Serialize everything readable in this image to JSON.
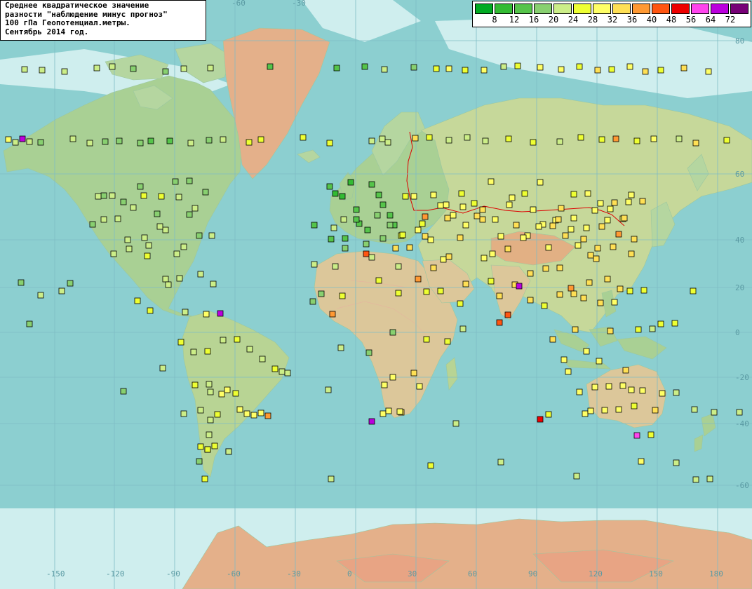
{
  "title": {
    "lines": [
      "Среднее квадратическое значение",
      "разности \"наблюдение минус прогноз\"",
      "100 гПа Геопотенциал.метры.",
      "Сентябрь 2014 год."
    ]
  },
  "legend": {
    "labels": [
      "8",
      "12",
      "16",
      "20",
      "24",
      "28",
      "32",
      "36",
      "40",
      "48",
      "56",
      "64",
      "72"
    ],
    "colors": [
      "#00aa22",
      "#33bb33",
      "#55c44a",
      "#88d070",
      "#ccee88",
      "#eeff33",
      "#ffff66",
      "#ffe055",
      "#ff9933",
      "#ff5511",
      "#ee0000",
      "#ff44ee",
      "#bb00dd",
      "#770077"
    ]
  },
  "map_colors": {
    "ocean": "#8ccfd0",
    "land_low": "#a3ce94",
    "land_mid": "#dcc79a",
    "land_high": "#e8a484",
    "ice": "#ccecee",
    "border": "#dd0000",
    "grid": "#7fbcc4"
  },
  "grid": {
    "lon_labels": [
      "-150",
      "-120",
      "-90",
      "-60",
      "-30",
      "0",
      "30",
      "60",
      "90",
      "120",
      "150",
      "180"
    ],
    "lat_labels": [
      "80",
      "60",
      "40",
      "20",
      "0",
      "-20",
      "-40",
      "-60"
    ],
    "top_lon_labels": [
      "-60",
      "-30"
    ]
  },
  "stations": [
    [
      12,
      6
    ],
    [
      22,
      4
    ],
    [
      42,
      4
    ],
    [
      32,
      12
    ],
    [
      58,
      3
    ],
    [
      104,
      4
    ],
    [
      128,
      4
    ],
    [
      150,
      3
    ],
    [
      170,
      3
    ],
    [
      200,
      3
    ],
    [
      215,
      2
    ],
    [
      242,
      2
    ],
    [
      272,
      4
    ],
    [
      298,
      3
    ],
    [
      318,
      4
    ],
    [
      355,
      5
    ],
    [
      372,
      5
    ],
    [
      432,
      5
    ],
    [
      470,
      5
    ],
    [
      530,
      4
    ],
    [
      545,
      4
    ],
    [
      553,
      4
    ],
    [
      592,
      7
    ],
    [
      612,
      5
    ],
    [
      640,
      4
    ],
    [
      666,
      4
    ],
    [
      692,
      4
    ],
    [
      725,
      5
    ],
    [
      760,
      5
    ],
    [
      798,
      4
    ],
    [
      828,
      5
    ],
    [
      858,
      5
    ],
    [
      878,
      8
    ],
    [
      908,
      5
    ],
    [
      932,
      6
    ],
    [
      968,
      4
    ],
    [
      992,
      7
    ],
    [
      1036,
      5
    ],
    [
      35,
      4
    ],
    [
      60,
      4
    ],
    [
      92,
      4
    ],
    [
      138,
      4
    ],
    [
      160,
      4
    ],
    [
      190,
      3
    ],
    [
      236,
      3
    ],
    [
      262,
      4
    ],
    [
      300,
      4
    ],
    [
      385,
      2
    ],
    [
      480,
      2
    ],
    [
      520,
      2
    ],
    [
      548,
      4
    ],
    [
      590,
      3
    ],
    [
      622,
      5
    ],
    [
      640,
      6
    ],
    [
      663,
      5
    ],
    [
      690,
      6
    ],
    [
      718,
      4
    ],
    [
      738,
      5
    ],
    [
      770,
      6
    ],
    [
      800,
      6
    ],
    [
      826,
      5
    ],
    [
      852,
      7
    ],
    [
      872,
      5
    ],
    [
      898,
      6
    ],
    [
      920,
      7
    ],
    [
      942,
      5
    ],
    [
      975,
      7
    ],
    [
      1010,
      6
    ],
    [
      132,
      3
    ],
    [
      148,
      3
    ],
    [
      176,
      3
    ],
    [
      200,
      3
    ],
    [
      224,
      3
    ],
    [
      250,
      3
    ],
    [
      270,
      3
    ],
    [
      293,
      3
    ],
    [
      470,
      2
    ],
    [
      478,
      1
    ],
    [
      488,
      1
    ],
    [
      500,
      1
    ],
    [
      512,
      2
    ],
    [
      530,
      2
    ],
    [
      546,
      2
    ],
    [
      562,
      2
    ],
    [
      578,
      5
    ],
    [
      602,
      5
    ],
    [
      618,
      6
    ],
    [
      636,
      6
    ],
    [
      658,
      5
    ],
    [
      676,
      5
    ],
    [
      700,
      6
    ],
    [
      726,
      6
    ],
    [
      748,
      5
    ],
    [
      770,
      6
    ],
    [
      792,
      6
    ],
    [
      818,
      5
    ],
    [
      838,
      6
    ],
    [
      856,
      6
    ],
    [
      876,
      7
    ],
    [
      896,
      6
    ],
    [
      916,
      7
    ],
    [
      140,
      4
    ],
    [
      160,
      4
    ],
    [
      182,
      4
    ],
    [
      205,
      5
    ],
    [
      230,
      5
    ],
    [
      255,
      4
    ],
    [
      278,
      4
    ],
    [
      302,
      4
    ],
    [
      472,
      2
    ],
    [
      492,
      2
    ],
    [
      508,
      2
    ],
    [
      524,
      2
    ],
    [
      540,
      2
    ],
    [
      556,
      2
    ],
    [
      572,
      5
    ],
    [
      590,
      6
    ],
    [
      606,
      8
    ],
    [
      628,
      6
    ],
    [
      646,
      6
    ],
    [
      664,
      6
    ],
    [
      688,
      7
    ],
    [
      706,
      6
    ],
    [
      730,
      6
    ],
    [
      752,
      6
    ],
    [
      774,
      6
    ],
    [
      796,
      7
    ],
    [
      814,
      6
    ],
    [
      832,
      7
    ],
    [
      848,
      6
    ],
    [
      866,
      6
    ],
    [
      882,
      8
    ],
    [
      900,
      6
    ],
    [
      148,
      4
    ],
    [
      168,
      4
    ],
    [
      190,
      4
    ],
    [
      212,
      4
    ],
    [
      236,
      4
    ],
    [
      262,
      4
    ],
    [
      284,
      3
    ],
    [
      476,
      4
    ],
    [
      492,
      3
    ],
    [
      508,
      2
    ],
    [
      522,
      3
    ],
    [
      538,
      3
    ],
    [
      556,
      3
    ],
    [
      574,
      5
    ],
    [
      596,
      6
    ],
    [
      614,
      6
    ],
    [
      638,
      7
    ],
    [
      660,
      6
    ],
    [
      688,
      7
    ],
    [
      714,
      6
    ],
    [
      736,
      7
    ],
    [
      760,
      6
    ],
    [
      782,
      6
    ],
    [
      800,
      7
    ],
    [
      818,
      6
    ],
    [
      836,
      6
    ],
    [
      852,
      7
    ],
    [
      870,
      6
    ],
    [
      888,
      6
    ],
    [
      904,
      7
    ],
    [
      162,
      4
    ],
    [
      184,
      4
    ],
    [
      206,
      4
    ],
    [
      228,
      4
    ],
    [
      252,
      4
    ],
    [
      270,
      3
    ],
    [
      448,
      2
    ],
    [
      490,
      4
    ],
    [
      522,
      9
    ],
    [
      546,
      3
    ],
    [
      564,
      7
    ],
    [
      584,
      7
    ],
    [
      606,
      7
    ],
    [
      632,
      6
    ],
    [
      656,
      7
    ],
    [
      680,
      7
    ],
    [
      702,
      6
    ],
    [
      724,
      7
    ],
    [
      746,
      6
    ],
    [
      768,
      6
    ],
    [
      788,
      7
    ],
    [
      806,
      7
    ],
    [
      824,
      6
    ],
    [
      842,
      7
    ],
    [
      858,
      7
    ],
    [
      874,
      7
    ],
    [
      890,
      7
    ],
    [
      210,
      5
    ],
    [
      236,
      4
    ],
    [
      256,
      4
    ],
    [
      286,
      4
    ],
    [
      304,
      4
    ],
    [
      448,
      4
    ],
    [
      478,
      4
    ],
    [
      530,
      4
    ],
    [
      568,
      4
    ],
    [
      596,
      8
    ],
    [
      618,
      7
    ],
    [
      640,
      7
    ],
    [
      664,
      7
    ],
    [
      690,
      6
    ],
    [
      712,
      7
    ],
    [
      734,
      7
    ],
    [
      756,
      7
    ],
    [
      778,
      7
    ],
    [
      798,
      7
    ],
    [
      814,
      8
    ],
    [
      832,
      7
    ],
    [
      850,
      7
    ],
    [
      866,
      7
    ],
    [
      884,
      7
    ],
    [
      900,
      7
    ],
    [
      30,
      3
    ],
    [
      42,
      3
    ],
    [
      88,
      4
    ],
    [
      100,
      3
    ],
    [
      58,
      4
    ],
    [
      196,
      5
    ],
    [
      214,
      5
    ],
    [
      240,
      4
    ],
    [
      264,
      4
    ],
    [
      294,
      6
    ],
    [
      314,
      12
    ],
    [
      446,
      3
    ],
    [
      458,
      3
    ],
    [
      474,
      8
    ],
    [
      488,
      5
    ],
    [
      540,
      5
    ],
    [
      568,
      5
    ],
    [
      608,
      5
    ],
    [
      628,
      5
    ],
    [
      656,
      5
    ],
    [
      700,
      5
    ],
    [
      712,
      9
    ],
    [
      724,
      9
    ],
    [
      740,
      12
    ],
    [
      756,
      7
    ],
    [
      776,
      5
    ],
    [
      798,
      7
    ],
    [
      818,
      7
    ],
    [
      840,
      7
    ],
    [
      856,
      7
    ],
    [
      876,
      6
    ],
    [
      898,
      5
    ],
    [
      918,
      5
    ],
    [
      942,
      5
    ],
    [
      962,
      5
    ],
    [
      988,
      5
    ],
    [
      232,
      4
    ],
    [
      258,
      5
    ],
    [
      276,
      4
    ],
    [
      296,
      5
    ],
    [
      318,
      4
    ],
    [
      338,
      5
    ],
    [
      356,
      4
    ],
    [
      374,
      4
    ],
    [
      392,
      5
    ],
    [
      402,
      4
    ],
    [
      486,
      4
    ],
    [
      526,
      3
    ],
    [
      560,
      3
    ],
    [
      608,
      5
    ],
    [
      638,
      5
    ],
    [
      660,
      4
    ],
    [
      788,
      7
    ],
    [
      804,
      6
    ],
    [
      820,
      7
    ],
    [
      836,
      6
    ],
    [
      854,
      6
    ],
    [
      870,
      7
    ],
    [
      892,
      7
    ],
    [
      910,
      5
    ],
    [
      930,
      4
    ],
    [
      262,
      4
    ],
    [
      278,
      5
    ],
    [
      298,
      4
    ],
    [
      316,
      6
    ],
    [
      336,
      5
    ],
    [
      352,
      6
    ],
    [
      372,
      6
    ],
    [
      382,
      8
    ],
    [
      410,
      4
    ],
    [
      548,
      6
    ],
    [
      560,
      6
    ],
    [
      572,
      7
    ],
    [
      590,
      7
    ],
    [
      598,
      6
    ],
    [
      782,
      5
    ],
    [
      810,
      6
    ],
    [
      826,
      6
    ],
    [
      848,
      6
    ],
    [
      868,
      6
    ],
    [
      888,
      6
    ],
    [
      904,
      5
    ],
    [
      176,
      3
    ],
    [
      286,
      4
    ],
    [
      300,
      4
    ],
    [
      310,
      5
    ],
    [
      324,
      6
    ],
    [
      342,
      6
    ],
    [
      362,
      6
    ],
    [
      468,
      4
    ],
    [
      546,
      6
    ],
    [
      554,
      6
    ],
    [
      570,
      6
    ],
    [
      834,
      6
    ],
    [
      842,
      6
    ],
    [
      862,
      6
    ],
    [
      882,
      6
    ],
    [
      900,
      6
    ],
    [
      916,
      6
    ],
    [
      934,
      7
    ],
    [
      944,
      6
    ],
    [
      964,
      4
    ],
    [
      990,
      4
    ],
    [
      1018,
      4
    ],
    [
      1054,
      4
    ],
    [
      284,
      3
    ],
    [
      296,
      5
    ],
    [
      306,
      5
    ],
    [
      326,
      4
    ],
    [
      300,
      4
    ],
    [
      286,
      5
    ],
    [
      292,
      5
    ],
    [
      296,
      6
    ],
    [
      914,
      6
    ],
    [
      928,
      5
    ],
    [
      1012,
      4
    ],
    [
      992,
      4
    ],
    [
      964,
      4
    ],
    [
      326,
      4
    ],
    [
      298,
      4
    ],
    [
      296,
      5
    ],
    [
      530,
      12
    ],
    [
      472,
      4
    ],
    [
      614,
      5
    ],
    [
      650,
      4
    ],
    [
      714,
      4
    ],
    [
      770,
      10
    ],
    [
      822,
      4
    ],
    [
      908,
      11
    ]
  ]
}
